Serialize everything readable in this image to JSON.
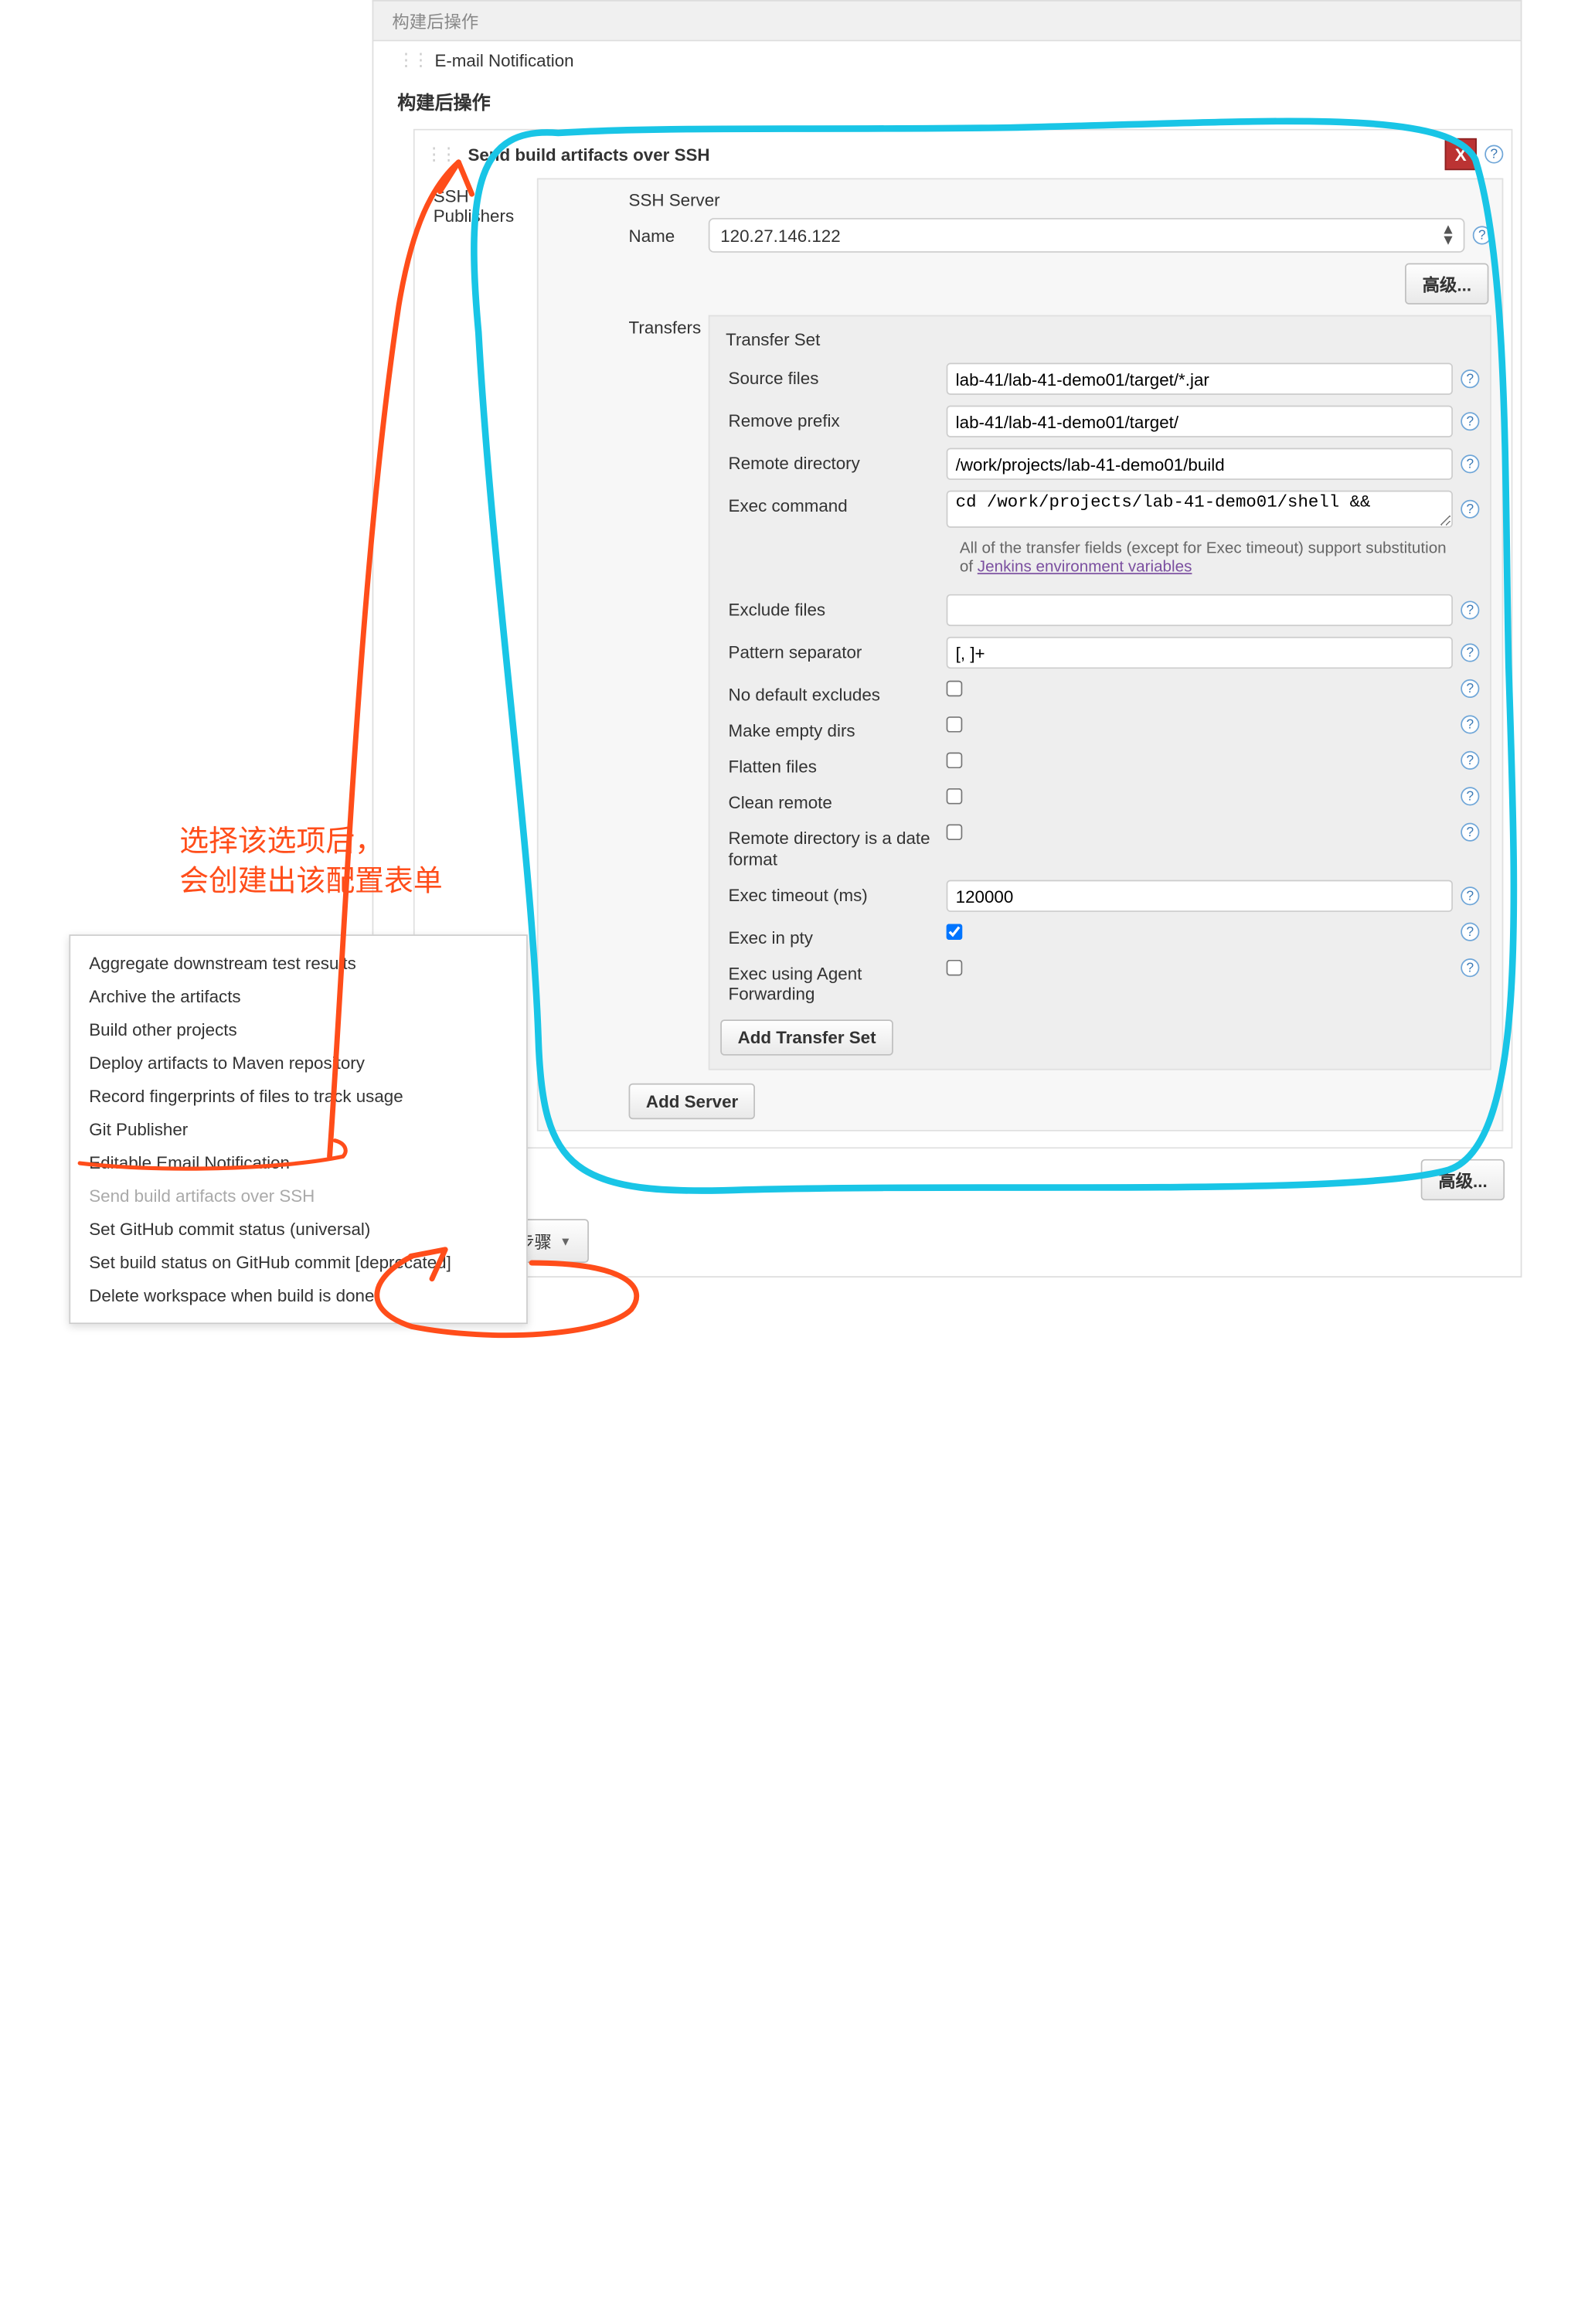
{
  "header": {
    "tab_label": "构建后操作",
    "email_notif": "E-mail Notification",
    "section_title": "构建后操作"
  },
  "ssh": {
    "title": "Send build artifacts over SSH",
    "publishers_label": "SSH Publishers",
    "server_section": "SSH Server",
    "name_label": "Name",
    "name_value": "120.27.146.122",
    "advanced_label": "高级...",
    "transfers_label": "Transfers",
    "transfer_set_title": "Transfer Set",
    "fields": {
      "source_files": {
        "label": "Source files",
        "value": "lab-41/lab-41-demo01/target/*.jar"
      },
      "remove_prefix": {
        "label": "Remove prefix",
        "value": "lab-41/lab-41-demo01/target/"
      },
      "remote_dir": {
        "label": "Remote directory",
        "value": "/work/projects/lab-41-demo01/build"
      },
      "exec_cmd": {
        "label": "Exec command",
        "value": "cd /work/projects/lab-41-demo01/shell &&"
      },
      "hint_pre": "All of the transfer fields (except for Exec timeout) support substitution of ",
      "hint_link": "Jenkins environment variables",
      "exclude": {
        "label": "Exclude files",
        "value": ""
      },
      "pattern_sep": {
        "label": "Pattern separator",
        "value": "[, ]+"
      },
      "no_default_excludes": {
        "label": "No default excludes"
      },
      "make_empty": {
        "label": "Make empty dirs"
      },
      "flatten": {
        "label": "Flatten files"
      },
      "clean_remote": {
        "label": "Clean remote"
      },
      "remote_date": {
        "label": "Remote directory is a date format"
      },
      "exec_timeout": {
        "label": "Exec timeout (ms)",
        "value": "120000"
      },
      "exec_pty": {
        "label": "Exec in pty"
      },
      "agent_fwd": {
        "label": "Exec using Agent Forwarding"
      }
    },
    "add_transfer_set": "Add Transfer Set",
    "add_server": "Add Server"
  },
  "add_step_btn": "增加构建后操作步骤",
  "popup": {
    "items": [
      "Aggregate downstream test results",
      "Archive the artifacts",
      "Build other projects",
      "Deploy artifacts to Maven repository",
      "Record fingerprints of files to track usage",
      "Git Publisher",
      "Editable Email Notification",
      "Send build artifacts over SSH",
      "Set GitHub commit status (universal)",
      "Set build status on GitHub commit [deprecated]",
      "Delete workspace when build is done"
    ],
    "disabled_index": 7
  },
  "annotations": {
    "line1": "选择该选项后，",
    "line2": "会创建出该配置表单"
  }
}
